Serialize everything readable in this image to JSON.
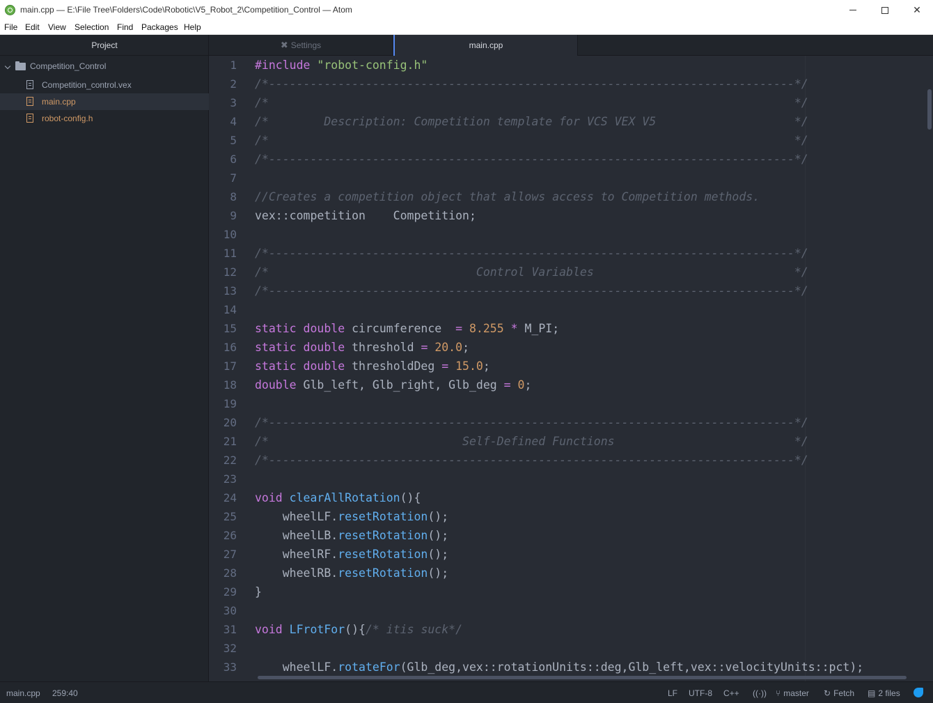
{
  "window": {
    "title": "main.cpp — E:\\File Tree\\Folders\\Code\\Robotic\\V5_Robot_2\\Competition_Control — Atom"
  },
  "menu": [
    "File",
    "Edit",
    "View",
    "Selection",
    "Find",
    "Packages",
    "Help"
  ],
  "tree": {
    "header": "Project",
    "root": "Competition_Control",
    "files": [
      {
        "name": "Competition_control.vex",
        "modified": false,
        "selected": false
      },
      {
        "name": "main.cpp",
        "modified": true,
        "selected": true
      },
      {
        "name": "robot-config.h",
        "modified": true,
        "selected": false
      }
    ]
  },
  "tabs": [
    {
      "label": "Settings",
      "icon": "wrench-icon",
      "active": false
    },
    {
      "label": "main.cpp",
      "active": true
    }
  ],
  "editor": {
    "line_numbers": [
      "1",
      "2",
      "3",
      "4",
      "5",
      "6",
      "7",
      "8",
      "9",
      "10",
      "11",
      "12",
      "13",
      "14",
      "15",
      "16",
      "17",
      "18",
      "19",
      "20",
      "21",
      "22",
      "23",
      "24",
      "25",
      "26",
      "27",
      "28",
      "29",
      "30",
      "31",
      "32",
      "33"
    ],
    "lines": [
      [
        [
          "kw",
          "#include "
        ],
        [
          "str",
          "\"robot-config.h\""
        ]
      ],
      [
        [
          "com",
          "/*----------------------------------------------------------------------------*/"
        ]
      ],
      [
        [
          "com",
          "/*                                                                            */"
        ]
      ],
      [
        [
          "com",
          "/*        Description: Competition template for VCS VEX V5                    */"
        ]
      ],
      [
        [
          "com",
          "/*                                                                            */"
        ]
      ],
      [
        [
          "com",
          "/*----------------------------------------------------------------------------*/"
        ]
      ],
      [],
      [
        [
          "com",
          "//Creates a competition object that allows access to Competition methods."
        ]
      ],
      [
        [
          "plain",
          "vex::competition    Competition;"
        ]
      ],
      [],
      [
        [
          "com",
          "/*----------------------------------------------------------------------------*/"
        ]
      ],
      [
        [
          "com",
          "/*                              Control Variables                             */"
        ]
      ],
      [
        [
          "com",
          "/*----------------------------------------------------------------------------*/"
        ]
      ],
      [],
      [
        [
          "kw",
          "static "
        ],
        [
          "kw",
          "double "
        ],
        [
          "plain",
          "circumference  "
        ],
        [
          "op",
          "= "
        ],
        [
          "num",
          "8.255 "
        ],
        [
          "op",
          "* "
        ],
        [
          "plain",
          "M_PI;"
        ]
      ],
      [
        [
          "kw",
          "static "
        ],
        [
          "kw",
          "double "
        ],
        [
          "plain",
          "threshold "
        ],
        [
          "op",
          "= "
        ],
        [
          "num",
          "20.0"
        ],
        [
          "plain",
          ";"
        ]
      ],
      [
        [
          "kw",
          "static "
        ],
        [
          "kw",
          "double "
        ],
        [
          "plain",
          "thresholdDeg "
        ],
        [
          "op",
          "= "
        ],
        [
          "num",
          "15.0"
        ],
        [
          "plain",
          ";"
        ]
      ],
      [
        [
          "kw",
          "double "
        ],
        [
          "plain",
          "Glb_left, Glb_right, Glb_deg "
        ],
        [
          "op",
          "= "
        ],
        [
          "num",
          "0"
        ],
        [
          "plain",
          ";"
        ]
      ],
      [],
      [
        [
          "com",
          "/*----------------------------------------------------------------------------*/"
        ]
      ],
      [
        [
          "com",
          "/*                            Self-Defined Functions                          */"
        ]
      ],
      [
        [
          "com",
          "/*----------------------------------------------------------------------------*/"
        ]
      ],
      [],
      [
        [
          "kw",
          "void "
        ],
        [
          "fn",
          "clearAllRotation"
        ],
        [
          "plain",
          "(){"
        ]
      ],
      [
        [
          "plain",
          "    wheelLF."
        ],
        [
          "fn",
          "resetRotation"
        ],
        [
          "plain",
          "();"
        ]
      ],
      [
        [
          "plain",
          "    wheelLB."
        ],
        [
          "fn",
          "resetRotation"
        ],
        [
          "plain",
          "();"
        ]
      ],
      [
        [
          "plain",
          "    wheelRF."
        ],
        [
          "fn",
          "resetRotation"
        ],
        [
          "plain",
          "();"
        ]
      ],
      [
        [
          "plain",
          "    wheelRB."
        ],
        [
          "fn",
          "resetRotation"
        ],
        [
          "plain",
          "();"
        ]
      ],
      [
        [
          "plain",
          "}"
        ]
      ],
      [],
      [
        [
          "kw",
          "void "
        ],
        [
          "fn",
          "LFrotFor"
        ],
        [
          "plain",
          "(){"
        ],
        [
          "com",
          "/* itis suck*/"
        ]
      ],
      [],
      [
        [
          "plain",
          "    wheelLF."
        ],
        [
          "fn",
          "rotateFor"
        ],
        [
          "plain",
          "(Glb_deg,vex::rotationUnits::deg,Glb_left,vex::velocityUnits::pct);"
        ]
      ]
    ]
  },
  "statusbar": {
    "file": "main.cpp",
    "cursor": "259:40",
    "line_ending": "LF",
    "encoding": "UTF-8",
    "grammar": "C++",
    "branch": "master",
    "fetch": "Fetch",
    "files_changed": "2 files"
  }
}
